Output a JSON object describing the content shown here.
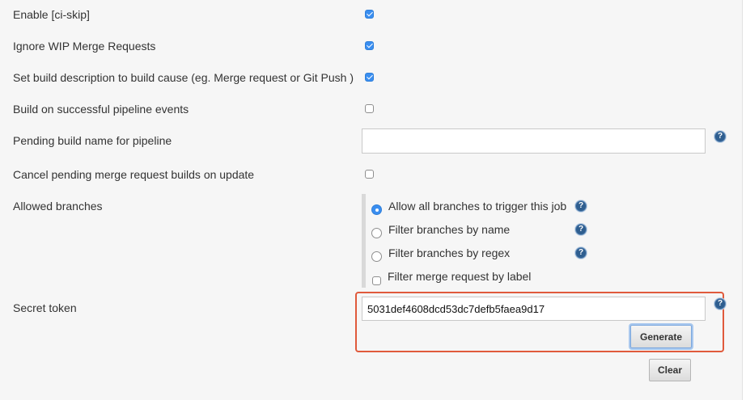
{
  "rows": {
    "ci_skip": {
      "label": "Enable [ci-skip]",
      "checked": true
    },
    "ignore_wip": {
      "label": "Ignore WIP Merge Requests",
      "checked": true
    },
    "build_description": {
      "label": "Set build description to build cause (eg. Merge request or Git Push )",
      "checked": true
    },
    "pipeline_events": {
      "label": "Build on successful pipeline events",
      "checked": false
    },
    "pending_build_name": {
      "label": "Pending build name for pipeline",
      "value": ""
    },
    "cancel_pending": {
      "label": "Cancel pending merge request builds on update",
      "checked": false
    },
    "allowed_branches": {
      "label": "Allowed branches",
      "options": [
        {
          "label": "Allow all branches to trigger this job",
          "selected": true
        },
        {
          "label": "Filter branches by name",
          "selected": false
        },
        {
          "label": "Filter branches by regex",
          "selected": false
        }
      ],
      "label_filter": {
        "label": "Filter merge request by label",
        "checked": false
      }
    },
    "secret_token": {
      "label": "Secret token",
      "value": "5031def4608dcd53dc7defb5faea9d17",
      "generate_label": "Generate",
      "clear_label": "Clear"
    }
  },
  "icons": {
    "help": "question-mark-help-icon"
  },
  "colors": {
    "accent": "#3a8ef0",
    "highlight": "#e05a3c",
    "help_icon": "#2f5e8f"
  },
  "help_glyph": "?"
}
